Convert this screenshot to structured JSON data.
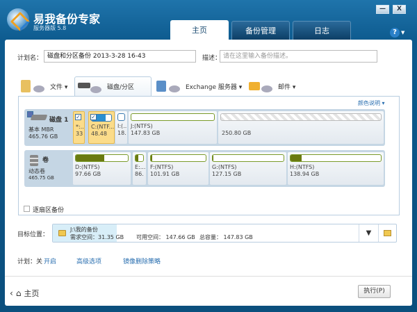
{
  "app": {
    "title": "易我备份专家",
    "subtitle": "服务器版 5.8",
    "minimize": "—",
    "close": "X",
    "help": "?"
  },
  "tabs": [
    {
      "label": "主页",
      "active": true
    },
    {
      "label": "备份管理"
    },
    {
      "label": "日志"
    }
  ],
  "plan": {
    "name_label": "计划名：",
    "name_value": "磁盘和分区备份 2013-3-28 16-43",
    "desc_label": "描述：",
    "desc_placeholder": "请在这里输入备份描述。"
  },
  "categories": [
    {
      "label": "文件 ▾",
      "icon": "folder-icon"
    },
    {
      "label": "磁盘/分区",
      "icon": "disk-icon",
      "active": true
    },
    {
      "label": "Exchange 服务器 ▾",
      "icon": "exchange-icon"
    },
    {
      "label": "邮件 ▾",
      "icon": "mail-icon"
    }
  ],
  "legend": "颜色说明 ▾",
  "disk": {
    "name": "磁盘 1",
    "type": "基本 MBR",
    "size": "465.76 GB",
    "partitions": [
      {
        "name": "*:...",
        "size": "33",
        "checked": true,
        "used": 0.6
      },
      {
        "name": "C:(NTF...",
        "size": "48.48",
        "checked": true,
        "used": 0.7
      },
      {
        "name": "I:(...",
        "size": "18.",
        "checked": false,
        "used": 0
      },
      {
        "name": "J:(NTFS)",
        "size": "147.83 GB",
        "used": 0
      },
      {
        "name": "",
        "size": "250.80 GB",
        "unallocated": true
      }
    ]
  },
  "volume": {
    "name": "卷",
    "type": "动态卷",
    "size": "465.75 GB",
    "partitions": [
      {
        "name": "D:(NTFS)",
        "size": "97.66 GB",
        "used": 0.55
      },
      {
        "name": "E:...",
        "size": "86.",
        "used": 0.4
      },
      {
        "name": "F:(NTFS)",
        "size": "101.91 GB",
        "used": 0.02
      },
      {
        "name": "G:(NTFS)",
        "size": "127.15 GB",
        "used": 0.01
      },
      {
        "name": "H:(NTFS)",
        "size": "138.94 GB",
        "used": 0.12
      }
    ]
  },
  "sector_backup": "逐扇区备份",
  "target": {
    "label": "目标位置：",
    "path": "J:\\我的备份",
    "required": "需求空间：31.35 GB",
    "available": "可用空间： 147.66 GB",
    "total": "总容量： 147.83 GB"
  },
  "schedule": {
    "label": "计划：关",
    "enable": "开启",
    "advanced": "高级选项",
    "image_policy": "镜像删除策略"
  },
  "footer": {
    "back": "主页",
    "execute": "执行(P)"
  },
  "colors": {
    "frame": "#0d5a8e",
    "accent": "#2a6fb0",
    "selected": "#fbdc8a",
    "used": "#6a7a10"
  }
}
